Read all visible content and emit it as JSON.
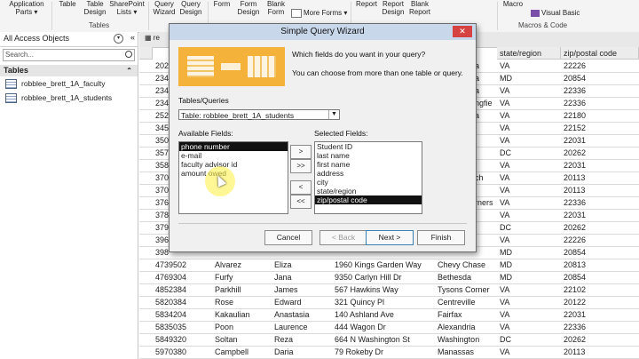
{
  "ribbon": {
    "buttons": [
      {
        "id": "app-parts",
        "label": "Application\nParts ▾"
      },
      {
        "id": "table",
        "label": "Table"
      },
      {
        "id": "table-design",
        "label": "Table\nDesign"
      },
      {
        "id": "sharepoint-lists",
        "label": "SharePoint\nLists ▾"
      },
      {
        "id": "query-wizard",
        "label": "Query\nWizard"
      },
      {
        "id": "query-design",
        "label": "Query\nDesign"
      },
      {
        "id": "form",
        "label": "Form"
      },
      {
        "id": "form-design",
        "label": "Form\nDesign"
      },
      {
        "id": "blank-form",
        "label": "Blank\nForm"
      },
      {
        "id": "more-forms",
        "label": "More Forms ▾"
      },
      {
        "id": "report",
        "label": "Report"
      },
      {
        "id": "report-design",
        "label": "Report\nDesign"
      },
      {
        "id": "blank-report",
        "label": "Blank\nReport"
      },
      {
        "id": "macro",
        "label": "Macro"
      },
      {
        "id": "visual-basic",
        "label": "Visual Basic"
      }
    ],
    "groups": {
      "tables": "Tables",
      "macros": "Macros & Code"
    }
  },
  "nav": {
    "title": "All Access Objects",
    "search_placeholder": "Search...",
    "group": "Tables",
    "items": [
      "robblee_brett_1A_faculty",
      "robblee_brett_1A_students"
    ]
  },
  "grid": {
    "tab_label": "robblee_brett_1A_students",
    "headers": [
      "state/region",
      "zip/postal code"
    ],
    "rows_top": [
      [
        "VA",
        "22226"
      ],
      [
        "MD",
        "20854"
      ],
      [
        "VA",
        "22336"
      ],
      [
        "VA",
        "22336"
      ],
      [
        "VA",
        "22180"
      ],
      [
        "VA",
        "22152"
      ],
      [
        "VA",
        "22031"
      ],
      [
        "DC",
        "20262"
      ],
      [
        "VA",
        "22031"
      ],
      [
        "VA",
        "20113"
      ],
      [
        "VA",
        "20113"
      ],
      [
        "VA",
        "22336"
      ],
      [
        "VA",
        "22031"
      ],
      [
        "DC",
        "20262"
      ],
      [
        "VA",
        "22226"
      ],
      [
        "MD",
        "20854"
      ]
    ],
    "partial_right": [
      "a",
      "a",
      "a",
      "ngfie",
      "a",
      "",
      "",
      "",
      "",
      "ch",
      "",
      "rners"
    ],
    "rows_bottom": [
      [
        "4739502",
        "Alvarez",
        "Eliza",
        "1960 Kings Garden Way",
        "Chevy Chase",
        "MD",
        "20813"
      ],
      [
        "4769304",
        "Furfy",
        "Jana",
        "9350 Carlyn Hill Dr",
        "Bethesda",
        "MD",
        "20854"
      ],
      [
        "4852384",
        "Parkhill",
        "James",
        "567 Hawkins Way",
        "Tysons Corner",
        "VA",
        "22102"
      ],
      [
        "5820384",
        "Rose",
        "Edward",
        "321 Quincy Pl",
        "Centreville",
        "VA",
        "20122"
      ],
      [
        "5834204",
        "Kakaulian",
        "Anastasia",
        "140 Ashland Ave",
        "Fairfax",
        "VA",
        "22031"
      ],
      [
        "5835035",
        "Poon",
        "Laurence",
        "444 Wagon Dr",
        "Alexandria",
        "VA",
        "22336"
      ],
      [
        "5849320",
        "Soltan",
        "Reza",
        "664 N Washington St",
        "Washington",
        "DC",
        "20262"
      ],
      [
        "5970380",
        "Campbell",
        "Daria",
        "79 Rokeby Dr",
        "Manassas",
        "VA",
        "20113"
      ]
    ],
    "left_ids": [
      "202",
      "234",
      "234",
      "234",
      "252",
      "345",
      "350",
      "357",
      "358",
      "370",
      "370",
      "376",
      "378",
      "379",
      "396",
      "398"
    ]
  },
  "dialog": {
    "title": "Simple Query Wizard",
    "intro1": "Which fields do you want in your query?",
    "intro2": "You can choose from more than one table or query.",
    "tables_label": "Tables/Queries",
    "table_value": "Table: robblee_brett_1A_students",
    "available_label": "Available Fields:",
    "selected_label": "Selected Fields:",
    "available": [
      "phone number",
      "e-mail",
      "faculty advisor id",
      "amount owed"
    ],
    "selected": [
      "Student ID",
      "last name",
      "first name",
      "address",
      "city",
      "state/region",
      "zip/postal code"
    ],
    "move_one": ">",
    "move_all": ">>",
    "remove_one": "<",
    "remove_all": "<<",
    "cancel": "Cancel",
    "back": "< Back",
    "next": "Next >",
    "finish": "Finish"
  },
  "colors": {
    "dialog_title_bg": "#c9d7ea",
    "selection": "#111111",
    "wizard_banner": "#f5b23a"
  }
}
